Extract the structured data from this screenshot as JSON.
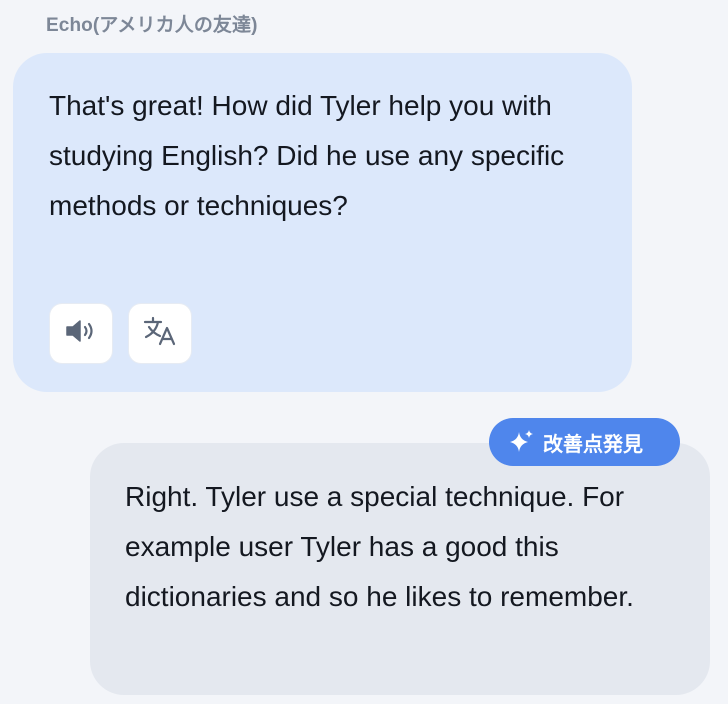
{
  "chat": {
    "sender_name": "Echo(アメリカ人の友達)",
    "bot_message": "That's great! How did Tyler help you with studying English? Did he use any specific methods or techniques?",
    "user_message": "Right. Tyler use a special technique. For example user Tyler has a good this dictionaries and so he likes to remember.",
    "improve_badge_label": "改善点発見"
  },
  "icons": {
    "speaker": "speaker-icon",
    "translate": "translate-icon",
    "sparkle": "sparkle-icon"
  },
  "colors": {
    "bot_bubble": "#dce8fb",
    "user_bubble": "#e4e8ef",
    "badge": "#4f86ec",
    "sender_name": "#7d8797"
  }
}
